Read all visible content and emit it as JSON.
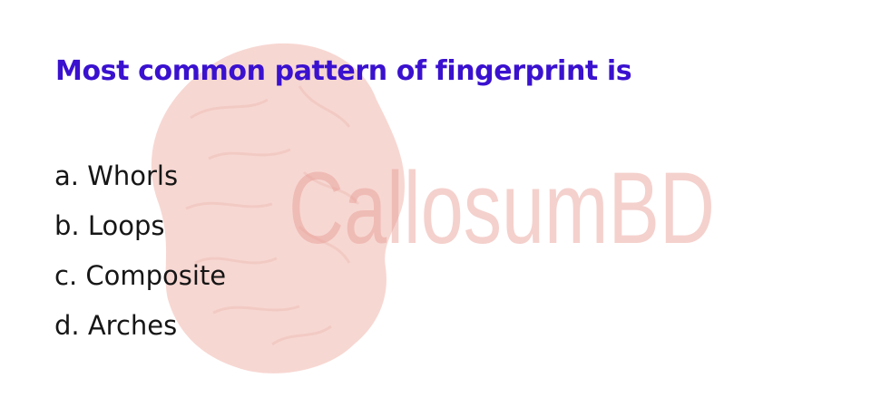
{
  "question": {
    "text": "Most common pattern of fingerprint is"
  },
  "options": [
    {
      "text": "a. Whorls"
    },
    {
      "text": "b. Loops"
    },
    {
      "text": "c. Composite"
    },
    {
      "text": "d. Arches"
    }
  ],
  "watermark": {
    "text": "CallosumBD",
    "icon": "brain-icon",
    "color": "#e79a92"
  },
  "colors": {
    "question": "#3a11cf",
    "option_text": "#161616",
    "background": "#ffffff"
  }
}
